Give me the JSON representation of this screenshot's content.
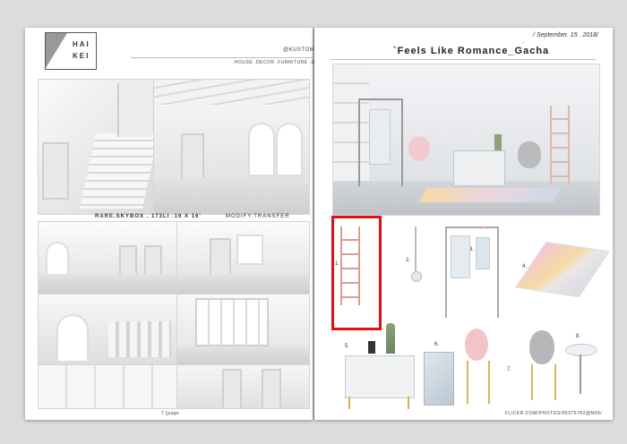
{
  "left_page": {
    "logo_line1": "HAI",
    "logo_line2": "KEI",
    "brand_handle": "@KUSTOMS",
    "categories": ".HOUSE .DECOR .FURNITURE .GACHA",
    "skybox_caption": "RARE.SKYBOX . 173LI .16 X 16'",
    "perm_caption": "MODIFY.TRANSFER",
    "page_number": "7 [page"
  },
  "right_page": {
    "date": "/ September. 15 . 2018/",
    "dot": "-",
    "title": "`Feels Like Romance_Gacha",
    "item_labels": [
      "1.",
      "2.",
      "3.",
      "4.",
      "5.",
      "6.",
      "7.",
      "8."
    ],
    "footer_url": "FLICKR.COM/PHOTOS/95376782@N08/"
  },
  "colors": {
    "highlight_box": "#e01010",
    "page_bg": "#ffffff",
    "backdrop": "#dcdcdc"
  }
}
